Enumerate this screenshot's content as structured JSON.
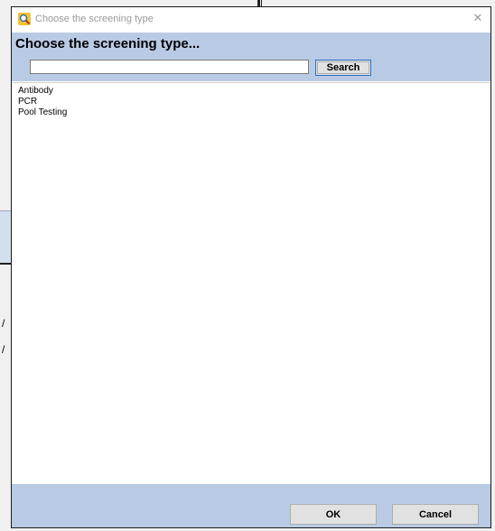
{
  "background": {
    "fragment_glyphs": [
      "/",
      "/"
    ]
  },
  "dialog": {
    "window_title": "Choose the screening type",
    "close_glyph": "✕",
    "heading": "Choose the screening type...",
    "search": {
      "value": "",
      "placeholder": "",
      "button_label": "Search"
    },
    "items": [
      {
        "label": "Antibody"
      },
      {
        "label": "PCR"
      },
      {
        "label": "Pool Testing"
      }
    ],
    "buttons": {
      "ok_label": "OK",
      "cancel_label": "Cancel"
    }
  },
  "colors": {
    "panel_blue": "#b9cbe4",
    "focus_blue": "#2b6cc4"
  }
}
